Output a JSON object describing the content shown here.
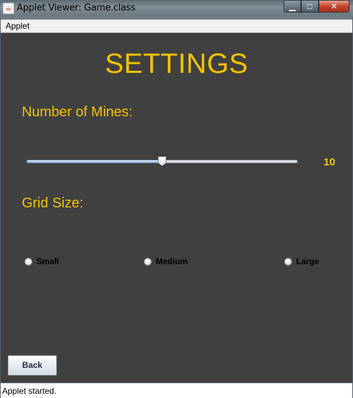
{
  "window": {
    "title": "Applet Viewer: Game.class",
    "icon": "java-cup-icon",
    "controls": {
      "minimize": "▁",
      "maximize": "□",
      "close": "✕"
    }
  },
  "menu": {
    "applet_label": "Applet"
  },
  "settings": {
    "heading": "SETTINGS",
    "mines_label": "Number of Mines:",
    "mines_value": "10",
    "mines_slider_fraction": 0.5,
    "grid_label": "Grid Size:",
    "grid_options": [
      "Small",
      "Medium",
      "Large"
    ],
    "back_label": "Back"
  },
  "status": {
    "text": "Applet started."
  },
  "colors": {
    "accent": "#f5c400",
    "panel_bg": "#404040"
  }
}
